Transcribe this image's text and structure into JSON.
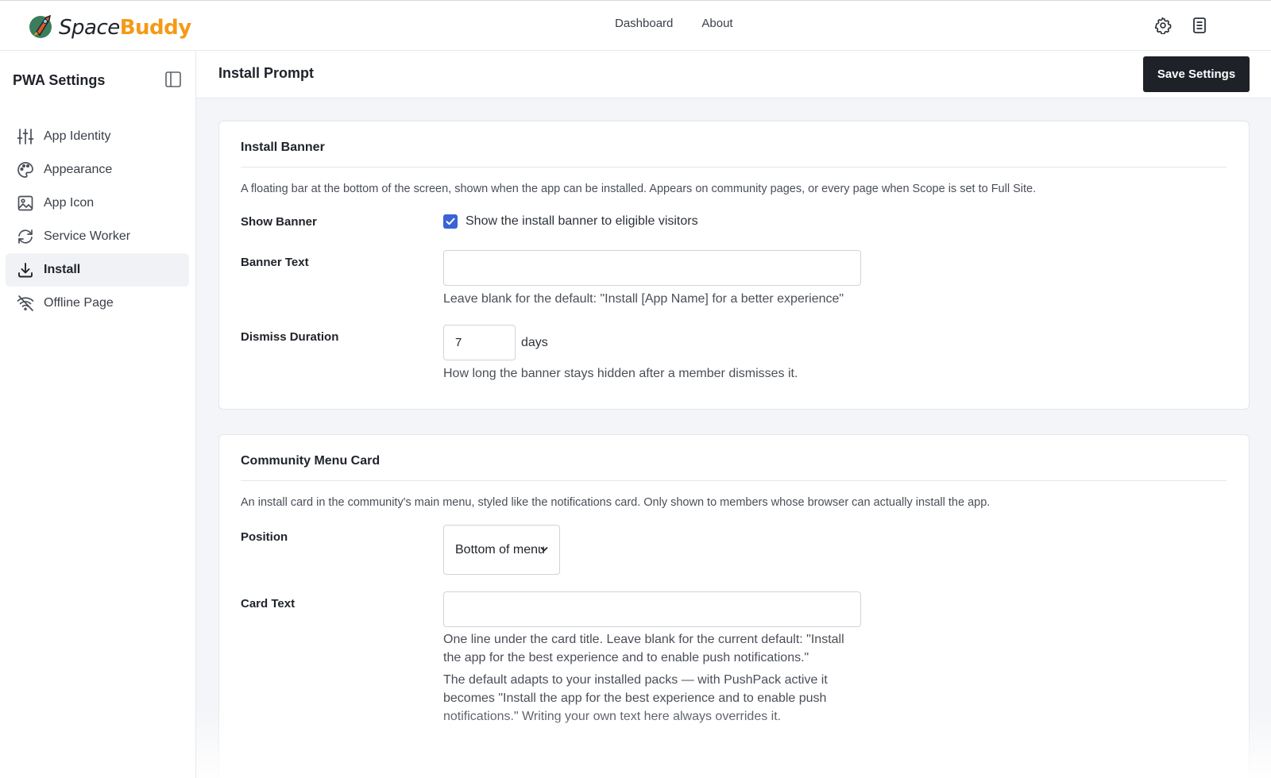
{
  "app": {
    "logo_word1": "Space",
    "logo_word2": "Buddy",
    "brand_color": "#f59a16"
  },
  "topnav": {
    "items": [
      {
        "label": "Dashboard"
      },
      {
        "label": "About"
      }
    ],
    "icons": [
      "gear-icon",
      "document-icon"
    ]
  },
  "sidebar": {
    "title": "PWA Settings",
    "items": [
      {
        "label": "App Identity",
        "icon": "sliders-icon"
      },
      {
        "label": "Appearance",
        "icon": "palette-icon"
      },
      {
        "label": "App Icon",
        "icon": "image-icon"
      },
      {
        "label": "Service Worker",
        "icon": "refresh-icon"
      },
      {
        "label": "Install",
        "icon": "download-icon",
        "active": true
      },
      {
        "label": "Offline Page",
        "icon": "wifi-off-icon"
      }
    ]
  },
  "main": {
    "page_title": "Install Prompt",
    "save_label": "Save Settings",
    "install_banner": {
      "title": "Install Banner",
      "description": "A floating bar at the bottom of the screen, shown when the app can be installed. Appears on community pages, or every page when Scope is set to Full Site.",
      "show_banner": {
        "label": "Show Banner",
        "checkbox_label": "Show the install banner to eligible visitors",
        "checked": true
      },
      "banner_text": {
        "label": "Banner Text",
        "value": "",
        "help": "Leave blank for the default: \"Install [App Name] for a better experience\""
      },
      "dismiss_duration": {
        "label": "Dismiss Duration",
        "value": "7",
        "unit": "days",
        "help": "How long the banner stays hidden after a member dismisses it."
      }
    },
    "community_menu_card": {
      "title": "Community Menu Card",
      "description": "An install card in the community's main menu, styled like the notifications card. Only shown to members whose browser can actually install the app.",
      "position": {
        "label": "Position",
        "selected": "Bottom of menu"
      },
      "card_text": {
        "label": "Card Text",
        "value": "",
        "help1": "One line under the card title. Leave blank for the current default: \"Install the app for the best experience and to enable push notifications.\"",
        "help2": "The default adapts to your installed packs — with PushPack active it becomes \"Install the app for the best experience and to enable push notifications.\" Writing your own text here always overrides it."
      }
    }
  },
  "colors": {
    "accent": "#3b63d6",
    "button_dark": "#1e2128"
  }
}
